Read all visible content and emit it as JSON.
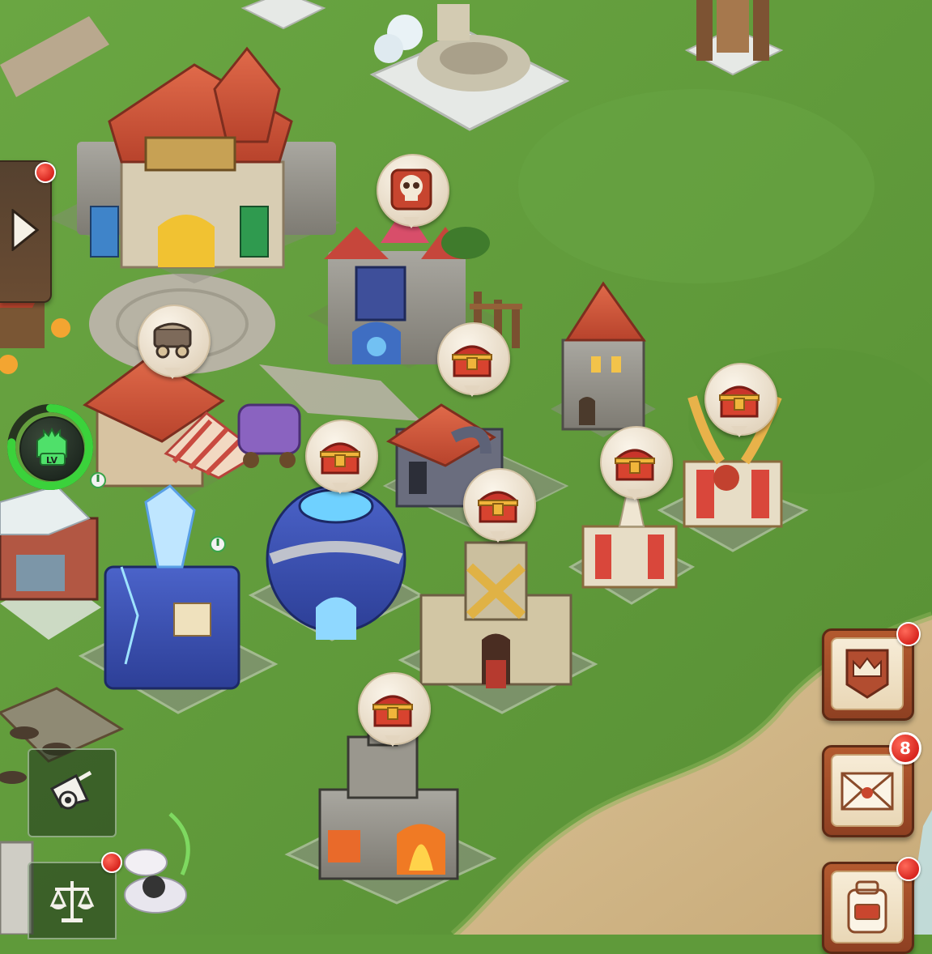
{
  "hud": {
    "level_icon_label": "LV",
    "mail_badge_count": "8"
  },
  "icons": {
    "side_panel_toggle": "play-arrow-icon",
    "level_up": "level-castle-icon",
    "shortcut_top": "rally-horn-icon",
    "shortcut_bottom": "scales-icon",
    "menu_top": "crown-banner-icon",
    "menu_mail": "mail-envelope-icon",
    "menu_bottom": "backpack-icon",
    "bubble_chest": "treasure-chest-icon",
    "bubble_skull": "skull-icon",
    "bubble_wagon": "wagon-icon"
  },
  "colors": {
    "grass": "#5f9a3a",
    "sand": "#cdb48a",
    "alert_red": "#d8261f",
    "ring_green": "#3bd23b"
  }
}
